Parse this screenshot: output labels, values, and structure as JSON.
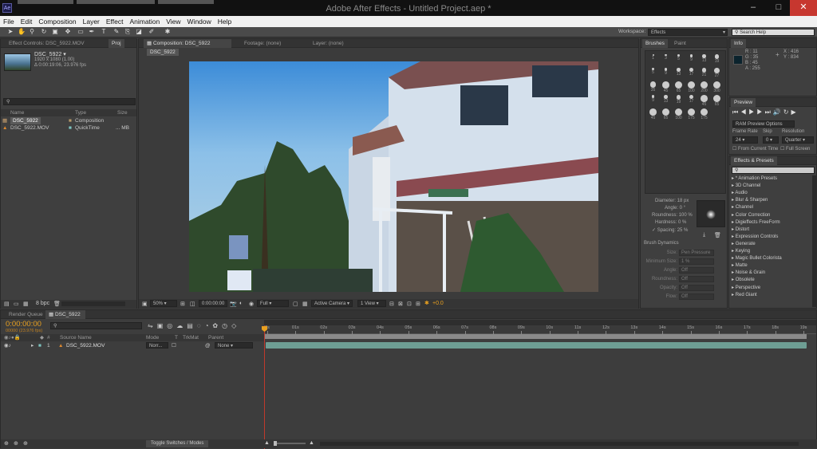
{
  "window": {
    "title": "Adobe After Effects - Untitled Project.aep *",
    "minimize": "–",
    "maximize": "□",
    "close": "✕"
  },
  "menu": [
    "File",
    "Edit",
    "Composition",
    "Layer",
    "Effect",
    "Animation",
    "View",
    "Window",
    "Help"
  ],
  "workspace": {
    "label": "Workspace:",
    "value": "Effects",
    "search_placeholder": "Search Help"
  },
  "project": {
    "tab_effect_controls": "Effect Controls: DSC_5922.MOV",
    "tab_project": "Proj",
    "item_name": "DSC_5922 ▾",
    "item_res": "1920 x 1080 (1.00)",
    "item_dur": "Δ 0:00:19:06, 23.976 fps",
    "columns": [
      "Name",
      "Type",
      "Size"
    ],
    "rows": [
      {
        "name": "DSC_5922",
        "type": "Composition",
        "size": ""
      },
      {
        "name": "DSC_5922.MOV",
        "type": "QuickTime",
        "size": "... MB"
      }
    ],
    "bpc": "8 bpc"
  },
  "comp": {
    "tab_comp": "Composition: DSC_5922",
    "tab_footage": "Footage: (none)",
    "tab_layer": "Layer: (none)",
    "subtab": "DSC_5922",
    "zoom": "50%",
    "time": "0:00:00:00",
    "resolution": "Full",
    "camera": "Active Camera",
    "views": "1 View",
    "exposure": "+0.0"
  },
  "brushes": {
    "tab_brushes": "Brushes",
    "tab_paint": "Paint",
    "sizes": [
      "1",
      "3",
      "5",
      "9",
      "13",
      "19",
      "5",
      "9",
      "13",
      "17",
      "21",
      "27",
      "35",
      "45",
      "65",
      "100",
      "200",
      "300",
      "9",
      "13",
      "19",
      "17",
      "45",
      "65",
      "45",
      "65",
      "100",
      "175",
      "175"
    ],
    "diameter": "Diameter: 18 px",
    "angle": "Angle: 0 °",
    "roundness": "Roundness: 100 %",
    "hardness": "Hardness: 0 %",
    "spacing": "Spacing: 25 %",
    "dynamics": "Brush Dynamics",
    "dyn_rows": [
      {
        "label": "Size:",
        "value": "Pen Pressure"
      },
      {
        "label": "Minimum Size:",
        "value": "1 %"
      },
      {
        "label": "Angle:",
        "value": "Off"
      },
      {
        "label": "Roundness:",
        "value": "Off"
      },
      {
        "label": "Opacity:",
        "value": "Off"
      },
      {
        "label": "Flow:",
        "value": "Off"
      }
    ]
  },
  "info": {
    "tab": "Info",
    "r": "R : 11",
    "g": "G : 35",
    "b": "B : 45",
    "a": "A : 255",
    "x": "X : 416",
    "y": "Y : 834",
    "color": "#0b232d"
  },
  "preview": {
    "tab": "Preview",
    "mode": "RAM Preview Options",
    "frame_rate_label": "Frame Rate",
    "skip_label": "Skip",
    "resolution_label": "Resolution",
    "frame_rate": "24",
    "skip": "0",
    "resolution": "Quarter",
    "from_current": "From Current Time",
    "full_screen": "Full Screen"
  },
  "effects": {
    "tab": "Effects & Presets",
    "search_placeholder": "",
    "items": [
      "* Animation Presets",
      "3D Channel",
      "Audio",
      "Blur & Sharpen",
      "Channel",
      "Color Correction",
      "Digieffects FreeForm",
      "Distort",
      "Expression Controls",
      "Generate",
      "Keying",
      "Magic Bullet Colorista",
      "Matte",
      "Noise & Grain",
      "Obsolete",
      "Perspective",
      "Red Giant"
    ]
  },
  "timeline": {
    "tab_render": "Render Queue",
    "tab_comp": "DSC_5922",
    "timecode": "0:00:00:00",
    "timecode_sub": "00000 (23.976 fps)",
    "col_source": "Source Name",
    "col_mode": "Mode",
    "col_t": "T",
    "col_trkmat": "TrkMat",
    "col_parent": "Parent",
    "layer_num": "1",
    "layer_name": "DSC_5922.MOV",
    "layer_mode": "Norr...",
    "layer_parent": "None",
    "ruler": [
      "0s",
      "01s",
      "02s",
      "03s",
      "04s",
      "05s",
      "06s",
      "07s",
      "08s",
      "09s",
      "10s",
      "11s",
      "12s",
      "13s",
      "14s",
      "15s",
      "16s",
      "17s",
      "18s",
      "19s"
    ],
    "toggle": "Toggle Switches / Modes"
  }
}
